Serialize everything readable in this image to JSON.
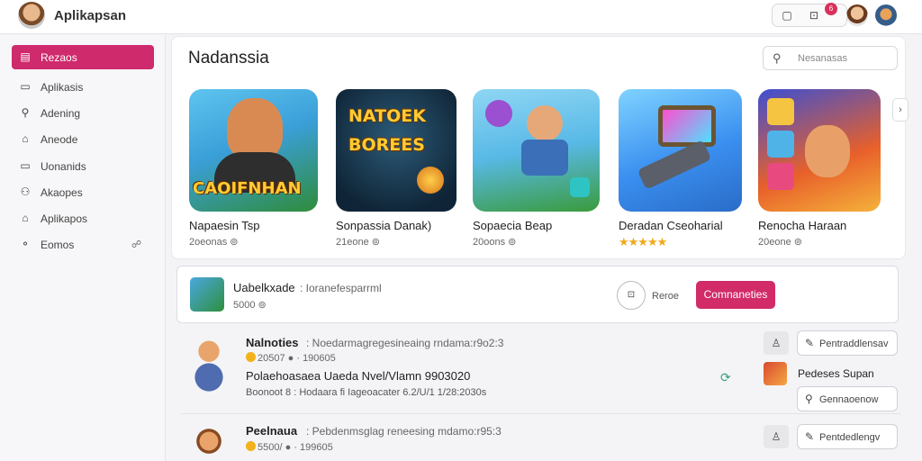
{
  "app": {
    "title": "Aplikapsan",
    "notif_count": "6"
  },
  "top_icons": [
    "▢",
    "⊡"
  ],
  "sidebar": {
    "items": [
      {
        "label": "Rezaos",
        "icon": "▤",
        "active": true
      },
      {
        "label": "Aplikasis",
        "icon": "▭"
      },
      {
        "label": "Adening",
        "icon": "⚲"
      },
      {
        "label": "Aneode",
        "icon": "⌂"
      },
      {
        "label": "Uonanids",
        "icon": "▭"
      },
      {
        "label": "Akaopes",
        "icon": "⚇"
      },
      {
        "label": "Aplikapos",
        "icon": "⌂"
      },
      {
        "label": "Eomos",
        "icon": "⚬",
        "badge": "☍"
      }
    ]
  },
  "hero": {
    "title": "Nadanssia",
    "search_placeholder": "Nesanasas",
    "cards": [
      {
        "title": "Napaesin Tsp",
        "sub": "2oeonas ⊚",
        "thumb_text": "CAOIFNHAN"
      },
      {
        "title": "Sonpassia Danak)",
        "sub": "21eone ⊚",
        "thumb_text": "NATOEK BOREES"
      },
      {
        "title": "Sopaecia Beap",
        "sub": "20oons ⊚",
        "thumb_text": ""
      },
      {
        "title": "Deradan Cseoharial",
        "sub": "★★★★★",
        "thumb_text": ""
      },
      {
        "title": "Renocha Haraan",
        "sub": "20eone ⊚",
        "thumb_text": ""
      }
    ],
    "scroll_arrow": "›"
  },
  "featured": {
    "title": "Uabelkxade",
    "desc": ": Ioranefesparrml",
    "price": "5000 ⊚",
    "circle_label": "⊡",
    "side_label": "Reroe",
    "button_label": "Comnaneties"
  },
  "rows": [
    {
      "title": "Nalnoties",
      "desc": ": Noedarmagregesineaing rndama:r9o2:3",
      "meta": "20507 ● · 190605",
      "line2": "Polaehoasaea Uaeda Nvel/Vlamn 9903020",
      "line3": "Boonoot 8 : Hodaara fi Iageoacater 6.2/U/1 1/28:2030s",
      "btn_label": "Pentraddlensav",
      "mini_label": "Pedeses Supan",
      "search_btn": "Gennaoenow"
    },
    {
      "title": "Peelnaua",
      "desc": ": Pebdenmsglag reneesing mdamo:r95:3",
      "meta": "5500/ ● · 199605",
      "btn_label": "Pentdedlengv"
    }
  ],
  "colors": {
    "accent": "#cf2a6c",
    "star": "#f0a81c"
  }
}
